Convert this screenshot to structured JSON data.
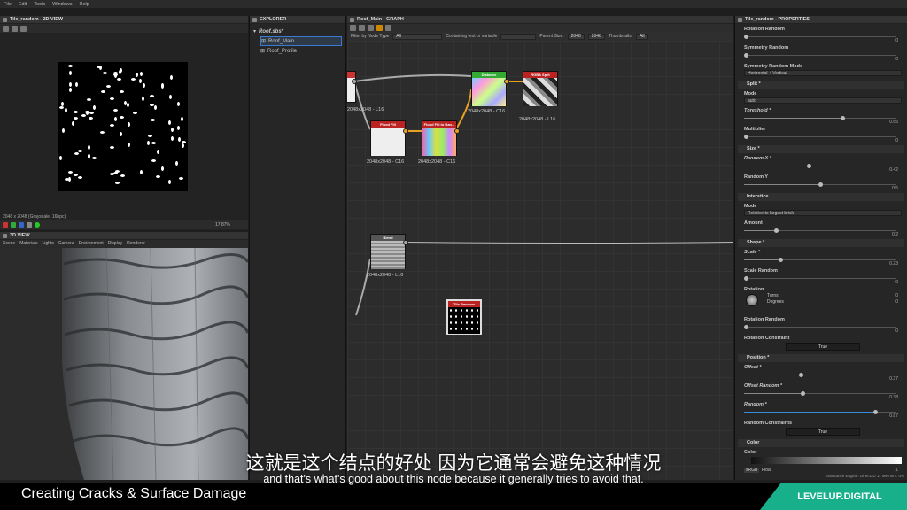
{
  "menu": [
    "File",
    "Edit",
    "Tools",
    "Windows",
    "Help"
  ],
  "view2d": {
    "title": "Tile_random - 2D VIEW",
    "status": "2048 x 2048 (Grayscale, 16bpc)",
    "zoom": "17.87%"
  },
  "view3d": {
    "title": "3D VIEW",
    "menu": [
      "Scene",
      "Materials",
      "Lights",
      "Camera",
      "Environment",
      "Display",
      "Renderer"
    ]
  },
  "explorer": {
    "title": "EXPLORER",
    "package": "Roof.sbs*",
    "items": [
      "Roof_Main",
      "Roof_Profile"
    ]
  },
  "graph": {
    "title": "Roof_Main - GRAPH",
    "filters": {
      "filter_label": "Filter by Node Type",
      "filter_value": "All",
      "contain_label": "Containing text or variable",
      "parent_label": "Parent Size:",
      "parent_value": "2048",
      "size2": "2048",
      "thumb_label": "Thumbnails:",
      "thumb_value": "All"
    },
    "nodes": [
      {
        "label": "2048x2048 - L16",
        "title": ""
      },
      {
        "label": "2048x2048 - C16",
        "title": "Flood Fill"
      },
      {
        "label": "2048x2048 - C16",
        "title": "Flood Fill to Ran..."
      },
      {
        "label": "2048x2048 - C16",
        "title": "Distance"
      },
      {
        "label": "2048x2048 - L16",
        "title": "RGBA Split"
      },
      {
        "label": "2048x2048 - L16",
        "title": "Blend"
      },
      {
        "label": "",
        "title": "Tile Random"
      }
    ]
  },
  "props": {
    "title": "Tile_random - PROPERTIES",
    "fields": [
      {
        "label": "Rotation Random",
        "value": "0"
      },
      {
        "label": "Symmetry Random",
        "value": "0"
      },
      {
        "label": "Symmetry Random Mode",
        "value": "Horizontal + Vertical"
      },
      {
        "section": "Split *"
      },
      {
        "label": "Mode",
        "value": "auto"
      },
      {
        "label": "Threshold *",
        "value": "0.65"
      },
      {
        "label": "Multiplier",
        "value": "0"
      },
      {
        "section": "Size *"
      },
      {
        "label": "Random X *",
        "value": "0.42"
      },
      {
        "label": "Random Y",
        "value": "0.5"
      },
      {
        "section": "Interstice"
      },
      {
        "label": "Mode",
        "value": "Relative to largest brick"
      },
      {
        "label": "Amount",
        "value": "0.2"
      },
      {
        "section": "Shape *"
      },
      {
        "label": "Scale *",
        "value": "0.23"
      },
      {
        "label": "Scale Random",
        "value": "0"
      },
      {
        "label": "Rotation",
        "turns": "Turns",
        "degrees": "Degrees",
        "v1": "0",
        "v2": "0"
      },
      {
        "label": "Rotation Random",
        "value": "0"
      },
      {
        "label": "Rotation Constraint",
        "value": "True"
      },
      {
        "section": "Position *"
      },
      {
        "label": "Offset *",
        "value": "0.37"
      },
      {
        "label": "Offset Random *",
        "value": "0.38"
      },
      {
        "label": "Random *",
        "value": "0.87"
      },
      {
        "label": "Random Constraints",
        "value": "True"
      },
      {
        "section": "Color"
      },
      {
        "label": "Color",
        "srgb": "sRGB",
        "float": "Float",
        "value": "1"
      }
    ],
    "engine": "Substance Engine: Direct3D 11   Memory: 0%"
  },
  "subtitles": {
    "cn": "这就是这个结点的好处 因为它通常会避免这种情况",
    "en": "and that's what's good about this node because it generally tries to avoid that."
  },
  "lower_title": "Creating Cracks & Surface Damage",
  "brand": "LEVELUP.DIGITAL"
}
